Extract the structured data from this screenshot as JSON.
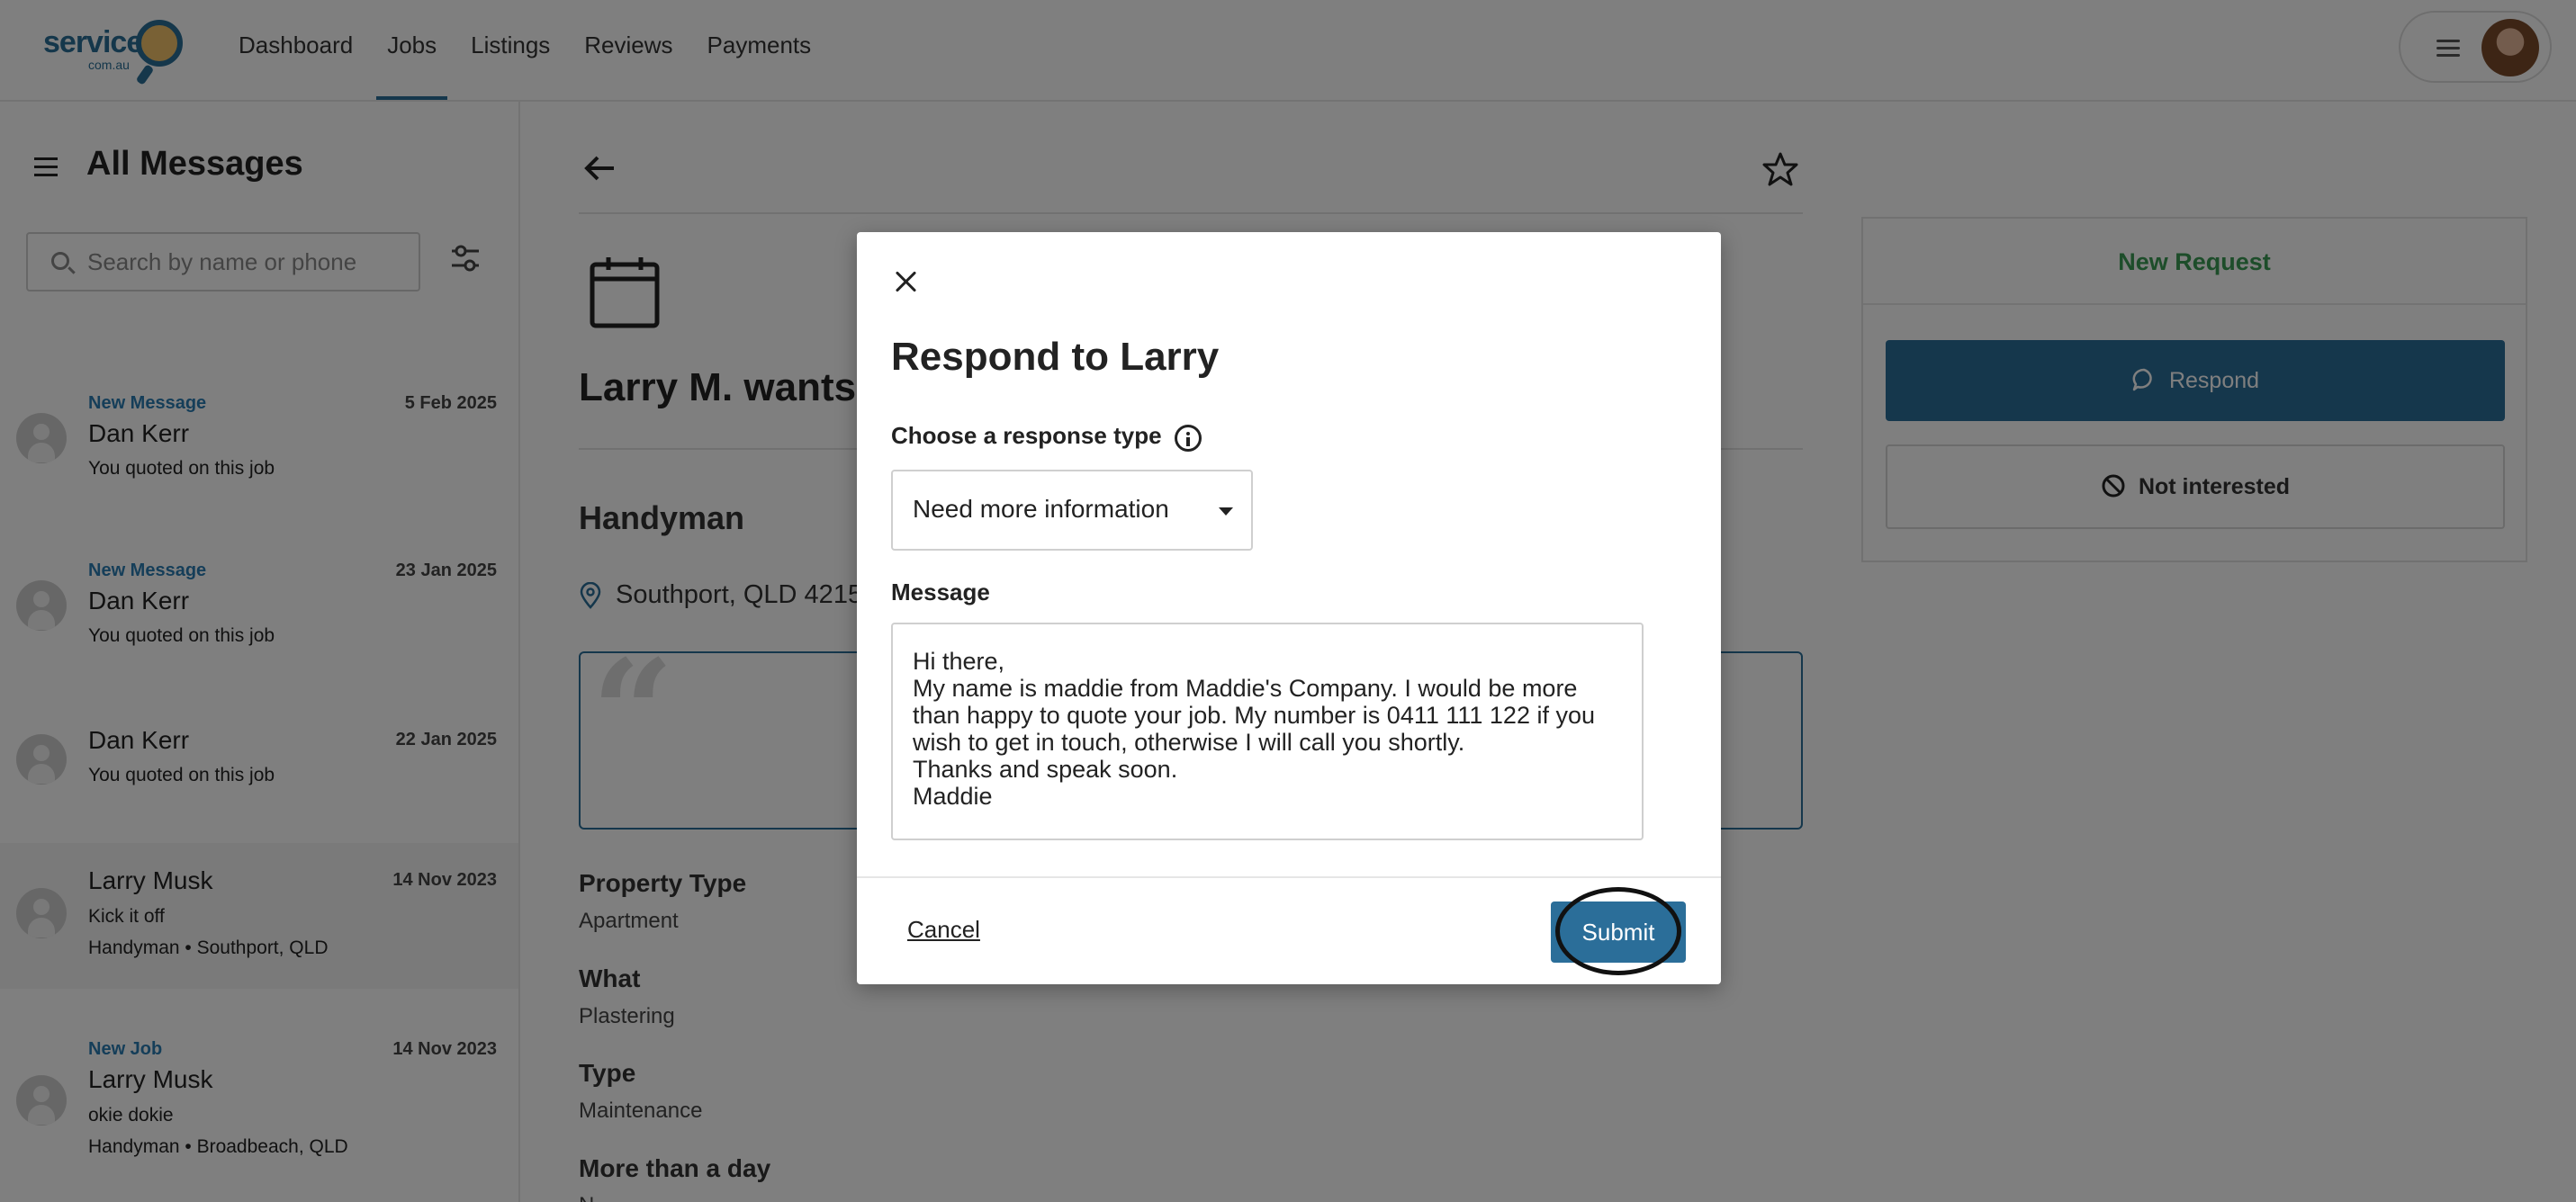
{
  "nav": {
    "logo_text": "service",
    "logo_sub": "com.au",
    "links": [
      "Dashboard",
      "Jobs",
      "Listings",
      "Reviews",
      "Payments"
    ],
    "active": "Jobs"
  },
  "sidebar": {
    "title": "All Messages",
    "search_placeholder": "Search by name or phone",
    "messages": [
      {
        "tag": "New Message",
        "name": "Dan Kerr",
        "date": "5 Feb 2025",
        "line1": "You quoted on this job",
        "line2": ""
      },
      {
        "tag": "New Message",
        "name": "Dan Kerr",
        "date": "23 Jan 2025",
        "line1": "You quoted on this job",
        "line2": ""
      },
      {
        "tag": "",
        "name": "Dan Kerr",
        "date": "22 Jan 2025",
        "line1": "You quoted on this job",
        "line2": ""
      },
      {
        "tag": "",
        "name": "Larry Musk",
        "date": "14 Nov 2023",
        "line1": "Kick it off",
        "line2": "Handyman • Southport, QLD"
      },
      {
        "tag": "New Job",
        "name": "Larry Musk",
        "date": "14 Nov 2023",
        "line1": "okie dokie",
        "line2": "Handyman • Broadbeach, QLD"
      }
    ]
  },
  "job": {
    "title": "Larry M. wants to",
    "category": "Handyman",
    "location": "Southport, QLD 4215",
    "properties": [
      {
        "label": "Property Type",
        "value": "Apartment"
      },
      {
        "label": "What",
        "value": "Plastering"
      },
      {
        "label": "Type",
        "value": "Maintenance"
      },
      {
        "label": "More than a day",
        "value": "N"
      }
    ]
  },
  "panel": {
    "title": "New Request",
    "respond_label": "Respond",
    "not_interested_label": "Not interested"
  },
  "modal": {
    "title": "Respond to Larry",
    "response_type_label": "Choose a response type",
    "response_type_value": "Need more information",
    "message_label": "Message",
    "message_text": "Hi there,\nMy name is maddie from Maddie's Company. I would be more than happy to quote your job. My number is 0411 111 122 if you wish to get in touch, otherwise I will call you shortly.\nThanks and speak soon.\nMaddie",
    "cancel_label": "Cancel",
    "submit_label": "Submit"
  },
  "colors": {
    "primary": "#2b6e99",
    "tag_blue": "#2b7cb3",
    "new_request_green": "#3a9b55"
  }
}
